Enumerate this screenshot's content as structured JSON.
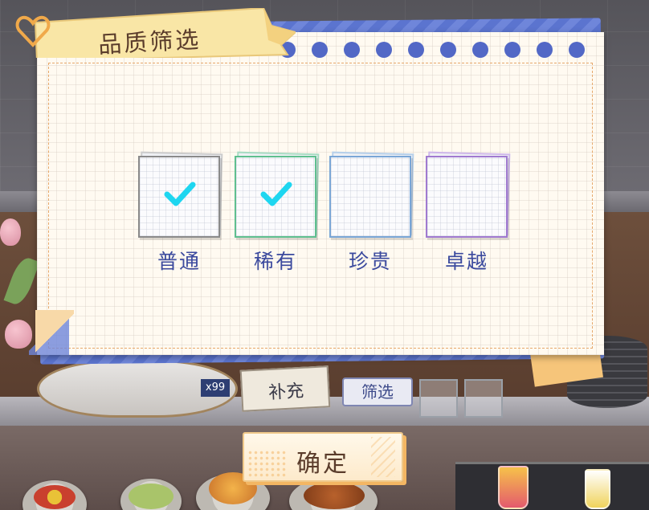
{
  "dialog": {
    "title": "品质筛选",
    "options": [
      {
        "label": "普通",
        "checked": true,
        "color": "#8a8a8a"
      },
      {
        "label": "稀有",
        "checked": true,
        "color": "#5fbf8f"
      },
      {
        "label": "珍贵",
        "checked": false,
        "color": "#7aa6d6"
      },
      {
        "label": "卓越",
        "checked": false,
        "color": "#a07ad0"
      }
    ],
    "confirm_label": "确定",
    "check_color": "#1ed6f0",
    "accent_blue": "#5268c6"
  },
  "background": {
    "sign_text": "补充",
    "filter_button_label": "筛选",
    "item_count_badge": "x99"
  }
}
